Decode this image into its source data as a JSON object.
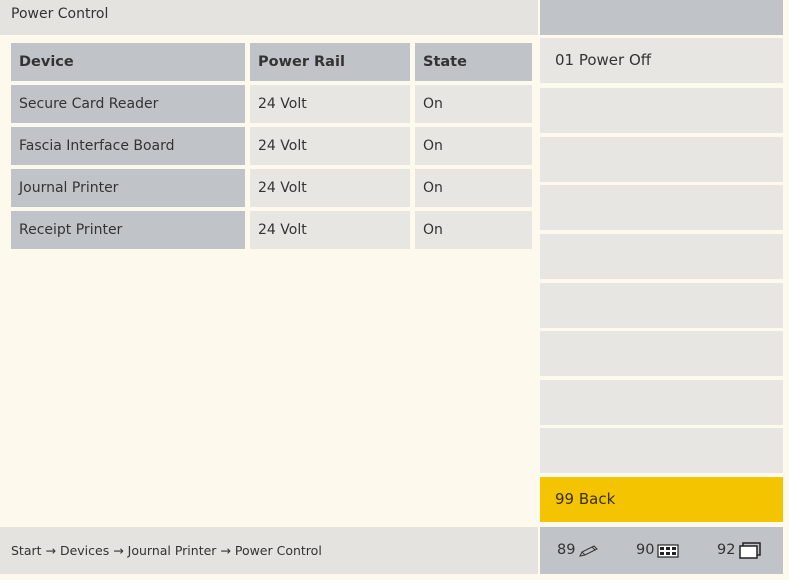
{
  "window": {
    "title": "Power Control"
  },
  "table": {
    "headers": [
      "Device",
      "Power Rail",
      "State"
    ],
    "rows": [
      [
        "Secure Card Reader",
        "24 Volt",
        "On"
      ],
      [
        "Fascia Interface Board",
        "24 Volt",
        "On"
      ],
      [
        "Journal Printer",
        "24 Volt",
        "On"
      ],
      [
        "Receipt Printer",
        "24 Volt",
        "On"
      ]
    ]
  },
  "side_menu": {
    "items": [
      "01 Power Off",
      "",
      "",
      "",
      "",
      "",
      "",
      "",
      ""
    ],
    "back_label": "99 Back"
  },
  "breadcrumb": {
    "text": "Start → Devices → Journal Printer → Power Control"
  },
  "shortcuts": [
    {
      "number": "89",
      "icon": "pencil-icon"
    },
    {
      "number": "90",
      "icon": "keyboard-icon"
    },
    {
      "number": "92",
      "icon": "windows-icon"
    }
  ],
  "colors": {
    "background": "#fdf9ed",
    "panel_gray": "#c0c4c8",
    "button_light": "#e7e6e2",
    "back_button": "#f5c400"
  }
}
